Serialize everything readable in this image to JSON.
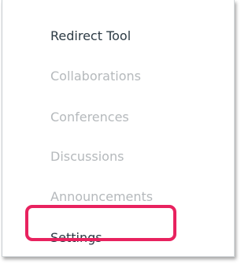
{
  "navigation": {
    "items": [
      {
        "label": "Redirect Tool",
        "state": "active"
      },
      {
        "label": "Collaborations",
        "state": "disabled"
      },
      {
        "label": "Conferences",
        "state": "disabled"
      },
      {
        "label": "Discussions",
        "state": "disabled"
      },
      {
        "label": "Announcements",
        "state": "disabled"
      },
      {
        "label": "Settings",
        "state": "active",
        "highlighted": true
      }
    ]
  },
  "colors": {
    "active_text": "#2d3b45",
    "disabled_text": "#b5b9bc",
    "highlight_border": "#e8225f"
  }
}
